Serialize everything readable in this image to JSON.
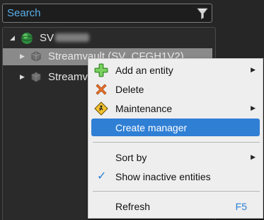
{
  "search": {
    "placeholder": "Search"
  },
  "tree": {
    "root": {
      "label": "SV"
    },
    "items": [
      {
        "label": "Streamvault (SV_CFGH1V2)"
      },
      {
        "label": "Streamvault"
      }
    ]
  },
  "context_menu": {
    "items": [
      {
        "label": "Add an entity",
        "icon": "plus-icon",
        "has_submenu": true
      },
      {
        "label": "Delete",
        "icon": "delete-x-icon"
      },
      {
        "label": "Maintenance",
        "icon": "maintenance-sign-icon",
        "has_submenu": true
      },
      {
        "label": "Create manager",
        "highlighted": true
      },
      {
        "label": "Sort by",
        "has_submenu": true
      },
      {
        "label": "Show inactive entities",
        "checked": true
      },
      {
        "label": "Refresh",
        "shortcut": "F5"
      }
    ]
  },
  "colors": {
    "accent": "#2f7fd5",
    "search_text": "#5aaee8",
    "background": "#262626",
    "menu_background": "#eeeeee"
  }
}
